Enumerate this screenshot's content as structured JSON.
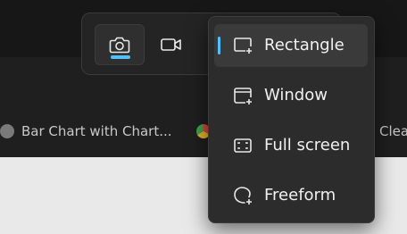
{
  "bookmarks": [
    {
      "label": "Bar Chart with Chart...",
      "icon": "globe-icon",
      "icon_color": "#7a7a7a"
    },
    {
      "label": "",
      "icon": "chrome-icon",
      "icon_color": "#c4902a"
    },
    {
      "label": "Clea",
      "icon": "",
      "icon_color": ""
    }
  ],
  "capture_toolbar": {
    "modes": [
      {
        "name": "camera-icon",
        "active": true
      },
      {
        "name": "video-camera-icon",
        "active": false
      }
    ],
    "accent_color": "#4cc2ff"
  },
  "shape_menu": {
    "items": [
      {
        "label": "Rectangle",
        "icon": "rectangle-snip-icon",
        "selected": true
      },
      {
        "label": "Window",
        "icon": "window-snip-icon",
        "selected": false
      },
      {
        "label": "Full screen",
        "icon": "full-screen-snip-icon",
        "selected": false
      },
      {
        "label": "Freeform",
        "icon": "freeform-snip-icon",
        "selected": false
      }
    ],
    "accent_color": "#4cc2ff"
  }
}
